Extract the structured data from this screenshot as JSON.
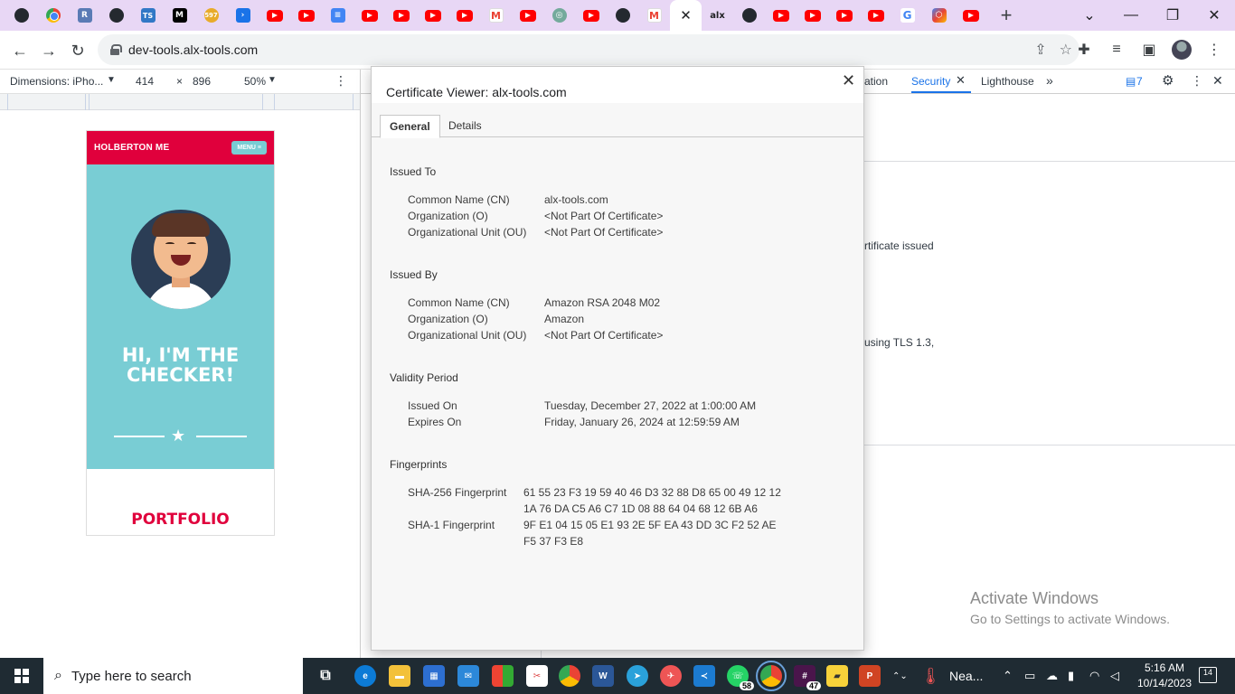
{
  "tabs": [
    {
      "icon": "github-icon",
      "glyph": ""
    },
    {
      "icon": "chrome-icon",
      "glyph": ""
    },
    {
      "icon": "r-icon",
      "glyph": "R"
    },
    {
      "icon": "github-icon",
      "glyph": ""
    },
    {
      "icon": "typescript-icon",
      "glyph": "TS"
    },
    {
      "icon": "medium-icon",
      "glyph": "M"
    },
    {
      "icon": "badge-597-icon",
      "glyph": "597"
    },
    {
      "icon": "arrow-app-icon",
      "glyph": "›"
    },
    {
      "icon": "youtube-icon",
      "glyph": ""
    },
    {
      "icon": "youtube-icon",
      "glyph": ""
    },
    {
      "icon": "google-docs-icon",
      "glyph": "≡"
    },
    {
      "icon": "youtube-icon",
      "glyph": ""
    },
    {
      "icon": "youtube-icon",
      "glyph": ""
    },
    {
      "icon": "youtube-icon",
      "glyph": ""
    },
    {
      "icon": "youtube-icon",
      "glyph": ""
    },
    {
      "icon": "gmail-icon",
      "glyph": "M"
    },
    {
      "icon": "youtube-icon",
      "glyph": ""
    },
    {
      "icon": "openai-icon",
      "glyph": "◎"
    },
    {
      "icon": "youtube-icon",
      "glyph": ""
    },
    {
      "icon": "github-icon",
      "glyph": ""
    },
    {
      "icon": "gmail-icon",
      "glyph": "M"
    },
    {
      "icon": "close-icon",
      "glyph": "✕",
      "active": true
    },
    {
      "icon": "alx-icon",
      "glyph": "alx"
    },
    {
      "icon": "github-icon",
      "glyph": ""
    },
    {
      "icon": "youtube-icon",
      "glyph": ""
    },
    {
      "icon": "youtube-icon",
      "glyph": ""
    },
    {
      "icon": "youtube-icon",
      "glyph": ""
    },
    {
      "icon": "youtube-icon",
      "glyph": ""
    },
    {
      "icon": "google-icon",
      "glyph": "G"
    },
    {
      "icon": "hex-app-icon",
      "glyph": "⬡"
    },
    {
      "icon": "youtube-icon",
      "glyph": ""
    }
  ],
  "toolbar": {
    "url": "dev-tools.alx-tools.com"
  },
  "devbar": {
    "dimensions_label": "Dimensions: iPho...",
    "width": "414",
    "times": "×",
    "height": "896",
    "zoom": "50%"
  },
  "phone": {
    "brand": "HOLBERTON ME",
    "menu": "MENU ≡",
    "hero_line1": "HI, I'M THE",
    "hero_line2": "CHECKER!",
    "portfolio": "PORTFOLIO"
  },
  "devtools": {
    "tab_partial": "ation",
    "tab_security": "Security",
    "tab_lighthouse": "Lighthouse",
    "more": "»",
    "issues_count": "7",
    "sec_text_1": "rtificate issued",
    "sec_text_2": "using TLS 1.3,"
  },
  "certificate": {
    "title": "Certificate Viewer: alx-tools.com",
    "tab_general": "General",
    "tab_details": "Details",
    "issued_to": {
      "heading": "Issued To",
      "rows": [
        {
          "label": "Common Name (CN)",
          "value": "alx-tools.com"
        },
        {
          "label": "Organization (O)",
          "value": "<Not Part Of Certificate>"
        },
        {
          "label": "Organizational Unit (OU)",
          "value": "<Not Part Of Certificate>"
        }
      ]
    },
    "issued_by": {
      "heading": "Issued By",
      "rows": [
        {
          "label": "Common Name (CN)",
          "value": "Amazon RSA 2048 M02"
        },
        {
          "label": "Organization (O)",
          "value": "Amazon"
        },
        {
          "label": "Organizational Unit (OU)",
          "value": "<Not Part Of Certificate>"
        }
      ]
    },
    "validity": {
      "heading": "Validity Period",
      "rows": [
        {
          "label": "Issued On",
          "value": "Tuesday, December 27, 2022 at 1:00:00 AM"
        },
        {
          "label": "Expires On",
          "value": "Friday, January 26, 2024 at 12:59:59 AM"
        }
      ]
    },
    "fingerprints": {
      "heading": "Fingerprints",
      "sha256_label": "SHA-256 Fingerprint",
      "sha256_value": "61 55 23 F3 19 59 40 46 D3 32 88 D8 65 00 49 12 12 1A 76 DA C5 A6 C7 1D 08 88 64 04 68 12 6B A6",
      "sha1_label": "SHA-1 Fingerprint",
      "sha1_value": "9F E1 04 15 05 E1 93 2E 5F EA 43 DD 3C F2 52 AE F5 37 F3 E8"
    }
  },
  "watermark": {
    "line1": "Activate Windows",
    "line2": "Go to Settings to activate Windows."
  },
  "taskbar": {
    "search_placeholder": "Type here to search",
    "weather": "Nea...",
    "time": "5:16 AM",
    "date": "10/14/2023",
    "notifications": "14",
    "whatsapp_badge": "58",
    "slack_badge": "47"
  }
}
